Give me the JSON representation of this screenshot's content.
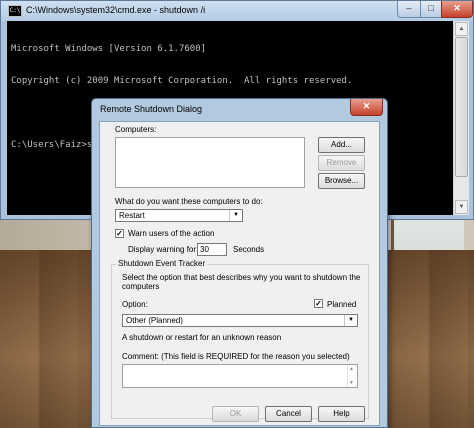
{
  "cmd": {
    "title": "C:\\Windows\\system32\\cmd.exe - shutdown /i",
    "icon": "C:\\",
    "controls": {
      "minimize": "–",
      "maximize": "□",
      "close": "✕"
    },
    "lines": [
      "Microsoft Windows [Version 6.1.7600]",
      "Copyright (c) 2009 Microsoft Corporation.  All rights reserved.",
      "",
      "C:\\Users\\Faiz>shutdown /i"
    ]
  },
  "dialog": {
    "title": "Remote Shutdown Dialog",
    "close": "✕",
    "computers_label": "Computers:",
    "add_button": "Add...",
    "remove_button": "Remove",
    "browse_button": "Browse...",
    "action_label": "What do you want these computers to do:",
    "action_value": "Restart",
    "warn_checked": true,
    "warn_label": "Warn users of the action",
    "display_warning_label": "Display warning for",
    "warning_seconds": "30",
    "seconds_label": "Seconds",
    "tracker_title": "Shutdown Event Tracker",
    "tracker_desc": "Select the option that best describes why you want to shutdown the computers",
    "option_label": "Option:",
    "planned_checked": true,
    "planned_label": "Planned",
    "option_value": "Other (Planned)",
    "option_desc": "A shutdown or restart for an unknown reason",
    "comment_label": "Comment: (This field is REQUIRED for the reason you selected)",
    "ok_button": "OK",
    "cancel_button": "Cancel",
    "help_button": "Help"
  },
  "icons": {
    "check": "✓",
    "dropdown": "▼",
    "scroll_up": "▲",
    "scroll_down": "▼"
  }
}
